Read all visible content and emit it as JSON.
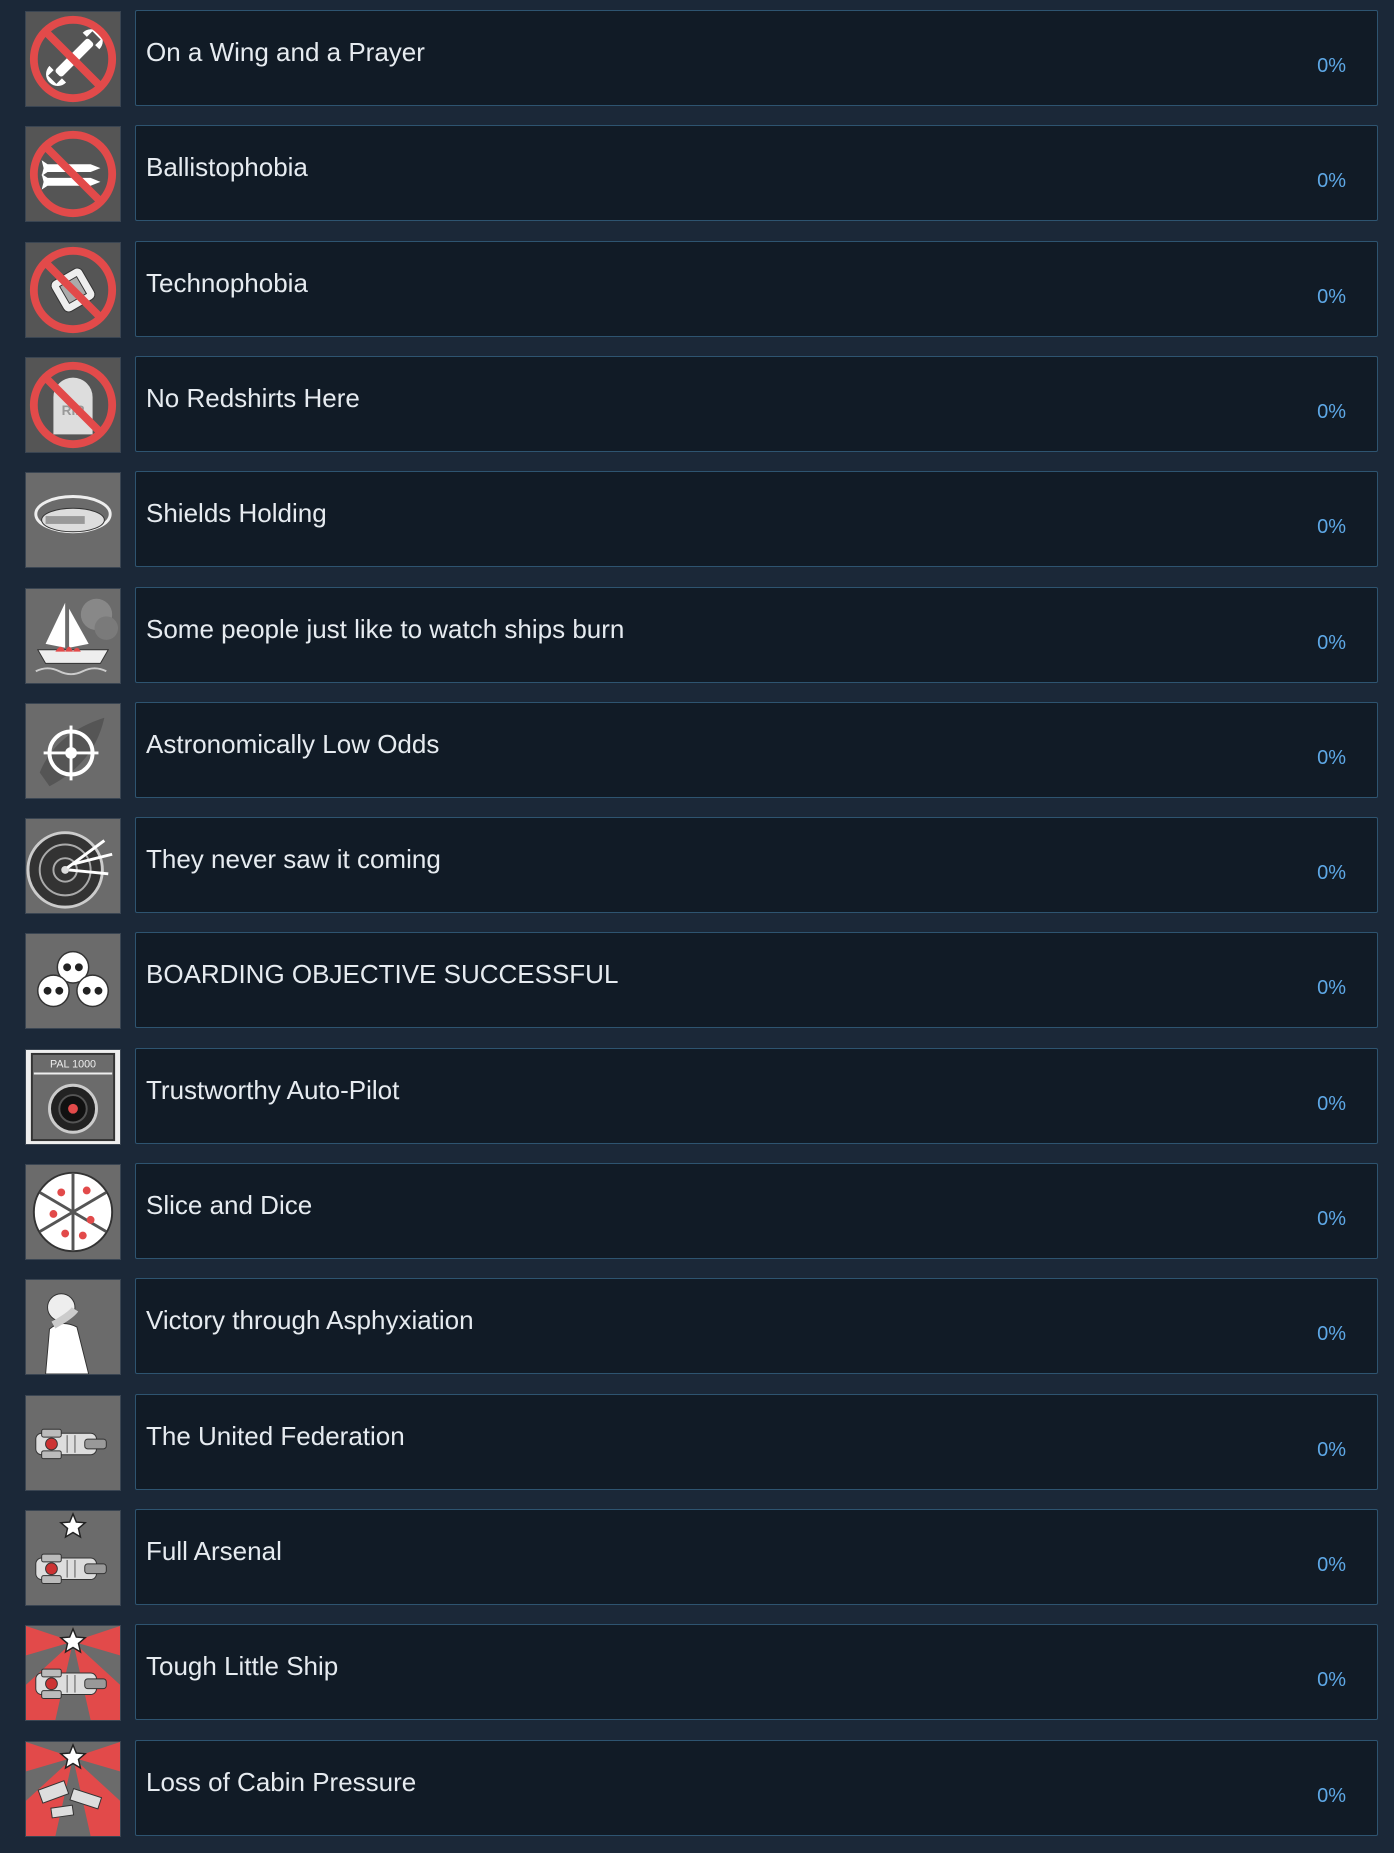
{
  "achievements": [
    {
      "name": "On a Wing and a Prayer",
      "percent": "0%",
      "icon": "no-wrench-icon"
    },
    {
      "name": "Ballistophobia",
      "percent": "0%",
      "icon": "no-missiles-icon"
    },
    {
      "name": "Technophobia",
      "percent": "0%",
      "icon": "no-drone-icon"
    },
    {
      "name": "No Redshirts Here",
      "percent": "0%",
      "icon": "no-tombstone-icon"
    },
    {
      "name": "Shields Holding",
      "percent": "0%",
      "icon": "shielded-ship-icon"
    },
    {
      "name": "Some people just like to watch ships burn",
      "percent": "0%",
      "icon": "burning-ship-icon"
    },
    {
      "name": "Astronomically Low Odds",
      "percent": "0%",
      "icon": "crosshair-asteroid-icon"
    },
    {
      "name": "They never saw it coming",
      "percent": "0%",
      "icon": "dartboard-icon"
    },
    {
      "name": "BOARDING OBJECTIVE SUCCESSFUL",
      "percent": "0%",
      "icon": "skulls-icon"
    },
    {
      "name": "Trustworthy Auto-Pilot",
      "percent": "0%",
      "icon": "ai-panel-icon",
      "icon_text": "PAL 1000"
    },
    {
      "name": "Slice and Dice",
      "percent": "0%",
      "icon": "pizza-icon"
    },
    {
      "name": "Victory through Asphyxiation",
      "percent": "0%",
      "icon": "choking-man-icon"
    },
    {
      "name": "The United Federation",
      "percent": "0%",
      "icon": "federation-ship-icon"
    },
    {
      "name": "Full Arsenal",
      "percent": "0%",
      "icon": "star-ship-icon"
    },
    {
      "name": "Tough Little Ship",
      "percent": "0%",
      "icon": "star-ship-red-rays-icon"
    },
    {
      "name": "Loss of Cabin Pressure",
      "percent": "0%",
      "icon": "star-ship-red-debris-icon"
    }
  ],
  "colors": {
    "page_background": "#1b2838",
    "panel_background": "#111b26",
    "panel_border": "#2e5470",
    "title_text": "#e6ebf0",
    "percent_text": "#5ea8e6",
    "prohibit_red": "#e24a4a",
    "icon_gray": "#6b6b6b"
  }
}
